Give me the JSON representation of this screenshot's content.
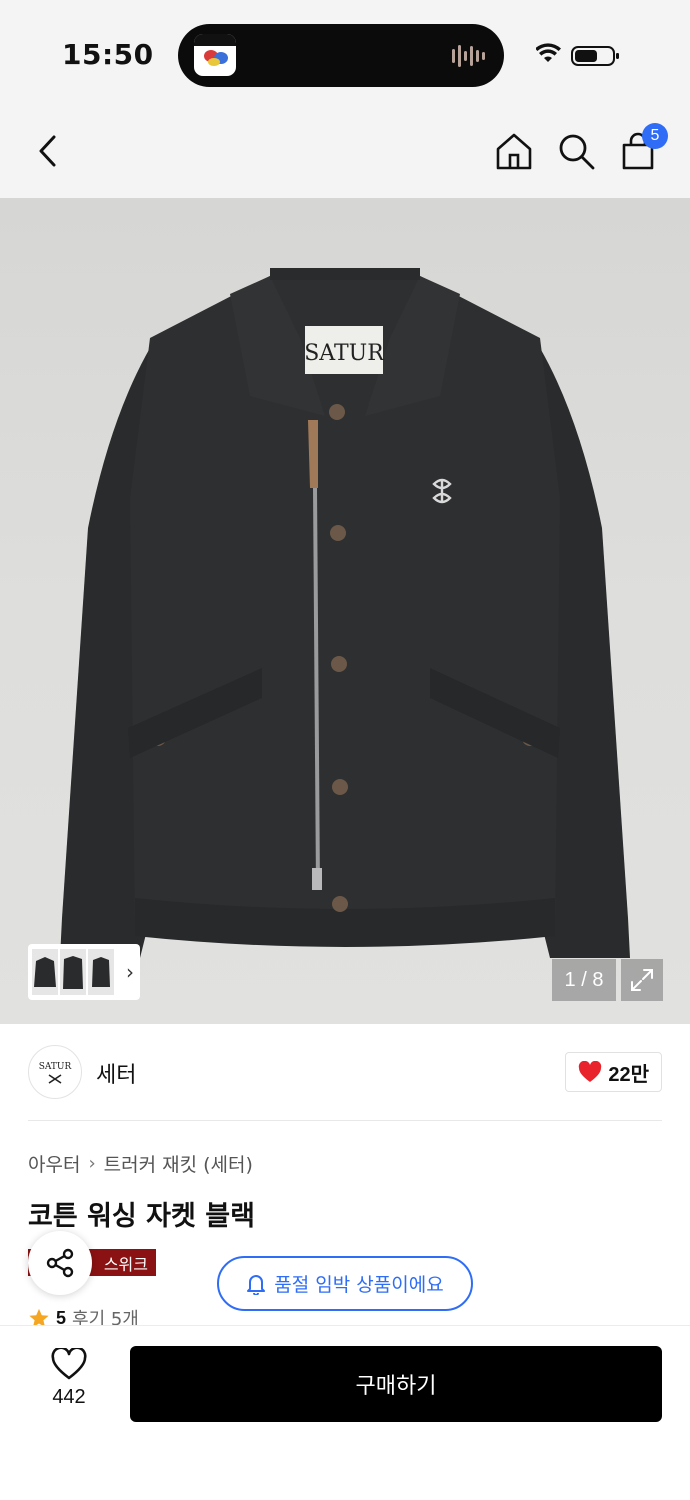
{
  "status_bar": {
    "time": "15:50",
    "island_app_icon": "music-app-icon",
    "icons": [
      "waveform-icon",
      "wifi-icon",
      "battery-icon"
    ]
  },
  "nav": {
    "back_icon": "chevron-left-icon",
    "home_icon": "home-icon",
    "search_icon": "search-icon",
    "cart_icon": "shopping-bag-icon",
    "cart_count": "5",
    "badge_color": "#2f6df6"
  },
  "gallery": {
    "counter": "1 / 8",
    "expand_icon": "expand-icon"
  },
  "brand": {
    "logo_text": "SATUR",
    "name": "세터",
    "like_count": "22만",
    "heart_color": "#e8232b"
  },
  "product": {
    "breadcrumb": [
      "아우터",
      "트러커 재킷 (세터)"
    ],
    "title": "코튼 워싱 자켓 블랙",
    "tag": "스위크",
    "tag_color": "#8b1212",
    "soldout_message": "품절 임박 상품이에요",
    "rating_score": "5",
    "review_label": "후기 5개"
  },
  "bottom_bar": {
    "wish_count": "442",
    "buy_label": "구매하기"
  }
}
